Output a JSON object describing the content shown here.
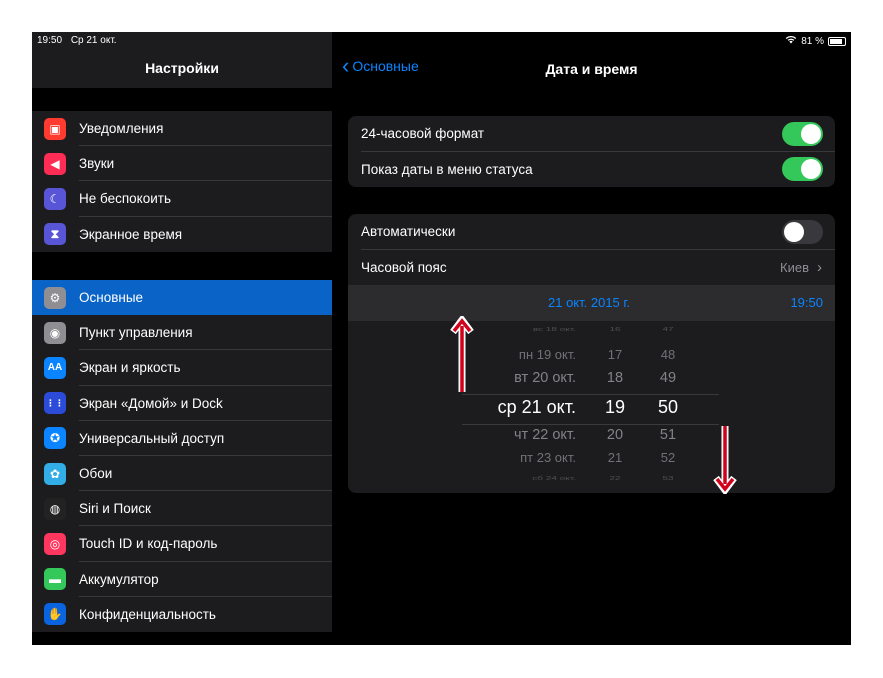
{
  "status_bar": {
    "time": "19:50",
    "date": "Ср 21 окт.",
    "battery": "81 %"
  },
  "sidebar": {
    "title": "Настройки",
    "groups": [
      [
        {
          "label": "Уведомления",
          "icon": "notifications-icon",
          "color": "#ff3b30"
        },
        {
          "label": "Звуки",
          "icon": "sounds-icon",
          "color": "#ff2d55"
        },
        {
          "label": "Не беспокоить",
          "icon": "moon-icon",
          "color": "#5856d6"
        },
        {
          "label": "Экранное время",
          "icon": "hourglass-icon",
          "color": "#5856d6"
        }
      ],
      [
        {
          "label": "Основные",
          "icon": "gear-icon",
          "color": "#8e8e93",
          "selected": true
        },
        {
          "label": "Пункт управления",
          "icon": "control-center-icon",
          "color": "#8e8e93"
        },
        {
          "label": "Экран и яркость",
          "icon": "display-icon",
          "color": "#0a84ff"
        },
        {
          "label": "Экран «Домой» и Dock",
          "icon": "home-screen-icon",
          "color": "#2c4bd8"
        },
        {
          "label": "Универсальный доступ",
          "icon": "accessibility-icon",
          "color": "#0a84ff"
        },
        {
          "label": "Обои",
          "icon": "wallpaper-icon",
          "color": "#32ade6"
        },
        {
          "label": "Siri и Поиск",
          "icon": "siri-icon",
          "color": "#222222"
        },
        {
          "label": "Touch ID и код-пароль",
          "icon": "fingerprint-icon",
          "color": "#ff375f"
        },
        {
          "label": "Аккумулятор",
          "icon": "battery-icon",
          "color": "#34c759"
        },
        {
          "label": "Конфиденциальность",
          "icon": "hand-icon",
          "color": "#0a64e0"
        }
      ]
    ]
  },
  "nav": {
    "back_label": "Основные",
    "title": "Дата и время"
  },
  "settings": {
    "format_24h": {
      "label": "24-часовой формат",
      "on": true
    },
    "status_date": {
      "label": "Показ даты в меню статуса",
      "on": true
    },
    "automatic": {
      "label": "Автоматически",
      "on": false
    },
    "timezone": {
      "label": "Часовой пояс",
      "value": "Киев"
    },
    "current_date": "21 окт. 2015 г.",
    "current_time": "19:50"
  },
  "picker": {
    "rows": [
      {
        "day": "вс 18 окт.",
        "hour": "16",
        "minute": "47"
      },
      {
        "day": "пн 19 окт.",
        "hour": "17",
        "minute": "48"
      },
      {
        "day": "вт 20 окт.",
        "hour": "18",
        "minute": "49"
      },
      {
        "day": "ср 21 окт.",
        "hour": "19",
        "minute": "50",
        "selected": true
      },
      {
        "day": "чт 22 окт.",
        "hour": "20",
        "minute": "51"
      },
      {
        "day": "пт 23 окт.",
        "hour": "21",
        "minute": "52"
      },
      {
        "day": "сб 24 окт.",
        "hour": "22",
        "minute": "53"
      }
    ]
  },
  "colors": {
    "accent": "#0a84ff",
    "toggle_on": "#34c759",
    "annotation_arrow": "#d0021b"
  }
}
